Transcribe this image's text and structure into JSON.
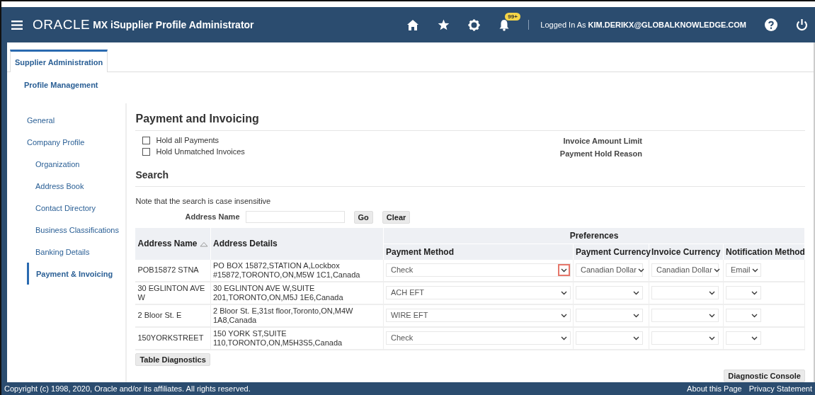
{
  "header": {
    "logo": "ORACLE",
    "app_title": "MX iSupplier Profile Administrator",
    "notification_badge": "99+",
    "logged_in_label": "Logged In As",
    "user": "KIM.DERIKX@GLOBALKNOWLEDGE.COM"
  },
  "tabs": [
    {
      "label": "Supplier Administration",
      "selected": true
    }
  ],
  "subtab": "Profile Management",
  "sidebar": {
    "items": [
      {
        "label": "General",
        "selected": false
      },
      {
        "label": "Company Profile",
        "selected": false,
        "children": [
          {
            "label": "Organization",
            "selected": false
          },
          {
            "label": "Address Book",
            "selected": false
          },
          {
            "label": "Contact Directory",
            "selected": false
          },
          {
            "label": "Business Classifications",
            "selected": false
          },
          {
            "label": "Banking Details",
            "selected": false
          },
          {
            "label": "Payment & Invoicing",
            "selected": true
          }
        ]
      }
    ]
  },
  "page_title": "Payment and Invoicing",
  "holds": [
    {
      "label": "Hold all Payments",
      "checked": false
    },
    {
      "label": "Hold Unmatched Invoices",
      "checked": false
    }
  ],
  "info_labels": [
    "Invoice Amount Limit",
    "Payment Hold Reason"
  ],
  "search": {
    "title": "Search",
    "note": "Note that the search is case insensitive",
    "field_label": "Address Name",
    "buttons": [
      "Go",
      "Clear"
    ]
  },
  "table": {
    "group_header": "Preferences",
    "columns": [
      {
        "label": "Address Name",
        "sorted": true
      },
      {
        "label": "Address Details",
        "sorted": false
      },
      {
        "label": "Payment Method",
        "sorted": false
      },
      {
        "label": "Payment Currency",
        "sorted": false
      },
      {
        "label": "Invoice Currency",
        "sorted": false
      },
      {
        "label": "Notification Method",
        "sorted": false
      }
    ],
    "rows": [
      {
        "address_name": "POB15872 STNA",
        "address_details": "PO BOX 15872,STATION A,Lockbox #15872,TORONTO,ON,M5W 1C1,Canada",
        "payment_method": "Check",
        "payment_currency": "Canadian Dollar",
        "invoice_currency": "Canadian Dollar",
        "notification_method": "Email",
        "chevron_highlighted": true
      },
      {
        "address_name": "30 EGLINTON AVE W",
        "address_details": "30 EGLINTON AVE W,SUITE 201,TORONTO,ON,M5J 1E6,Canada",
        "payment_method": "ACH EFT",
        "chevron_highlighted": false
      },
      {
        "address_name": "2 Bloor St. E",
        "address_details": "2 Bloor St. E,31st floor,Toronto,ON,M4W 1A8,Canada",
        "payment_method": "WIRE EFT",
        "chevron_highlighted": false
      },
      {
        "address_name": "150YORKSTREET",
        "address_details": "150 YORK ST,SUITE 110,TORONTO,ON,M5H3S5,Canada",
        "payment_method": "Check",
        "chevron_highlighted": false
      }
    ]
  },
  "table_button": "Table Diagnostics",
  "console_button": "Diagnostic Console",
  "footer": {
    "copyright": "Copyright (c) 1998, 2020, Oracle and/or its affiliates. All rights reserved.",
    "links": [
      "About this Page",
      "Privacy Statement"
    ]
  }
}
